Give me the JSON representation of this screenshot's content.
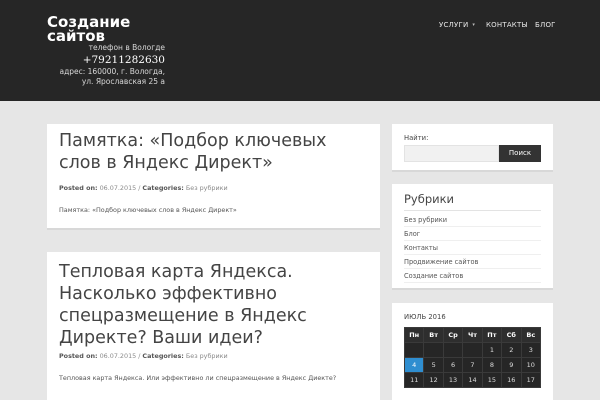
{
  "site": {
    "title": "Создание сайтов",
    "contact_label": "телефон в Вологде",
    "phone": "+79211282630",
    "address": "адрес: 160000, г. Вологда, ул. Ярославская 25 а"
  },
  "nav": {
    "items": [
      {
        "label": "УСЛУГИ",
        "has_dropdown": true
      },
      {
        "label": "КОНТАКТЫ",
        "has_dropdown": false
      },
      {
        "label": "БЛОГ",
        "has_dropdown": false
      }
    ]
  },
  "posts": [
    {
      "title": "Памятка: «Подбор ключевых слов в Яндекс Директ»",
      "posted_label": "Posted on:",
      "date": "06.07.2015",
      "categories_label": "Categories:",
      "category": "Без рубрики",
      "excerpt": "Памятка: «Подбор ключевых слов в Яндекс Директ»"
    },
    {
      "title": "Тепловая карта Яндекса. Насколько эффективно спецразмещение в Яндекс Директе? Ваши идеи?",
      "posted_label": "Posted on:",
      "date": "06.07.2015",
      "categories_label": "Categories:",
      "category": "Без рубрики",
      "excerpt": "Тепловая карта Яндекса. Или эффективно ли спецразмещение в Яндекс Диекте?"
    }
  ],
  "search": {
    "label": "Найти:",
    "value": "",
    "button_label": "Поиск"
  },
  "categories_widget": {
    "title": "Рубрики",
    "items": [
      "Без рубрики",
      "Блог",
      "Контакты",
      "Продвижение сайтов",
      "Создание сайтов"
    ]
  },
  "calendar": {
    "title": "ИЮЛЬ 2016",
    "weekdays": [
      "Пн",
      "Вт",
      "Ср",
      "Чт",
      "Пт",
      "Сб",
      "Вс"
    ],
    "rows": [
      [
        "",
        "",
        "",
        "",
        "1",
        "2",
        "3"
      ],
      [
        "4",
        "5",
        "6",
        "7",
        "8",
        "9",
        "10"
      ],
      [
        "11",
        "12",
        "13",
        "14",
        "15",
        "16",
        "17"
      ]
    ],
    "today": "4"
  },
  "colors": {
    "header_bg": "#262626",
    "page_bg": "#e6e6e6",
    "accent_today": "#2f8ed0"
  }
}
